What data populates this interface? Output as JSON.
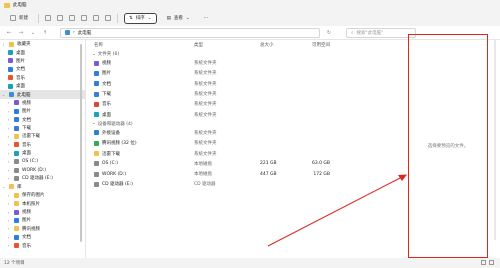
{
  "window": {
    "title": "此电脑"
  },
  "toolbar": {
    "new_label": "新建",
    "sort_label": "排序",
    "view_label": "查看",
    "more_label": "···"
  },
  "address": {
    "path_root": "此电脑",
    "search_placeholder": "搜索\"此电脑\""
  },
  "sidebar": {
    "items": [
      {
        "label": "收藏夹",
        "icon": "star-icon"
      },
      {
        "label": "桌面",
        "icon": "folder-icon"
      },
      {
        "label": "图片",
        "icon": "picture-icon"
      },
      {
        "label": "文档",
        "icon": "document-icon"
      },
      {
        "label": "音乐",
        "icon": "music-icon"
      },
      {
        "label": "桌面",
        "icon": "folder-icon"
      },
      {
        "label": "此电脑",
        "icon": "pc-icon",
        "active": true
      },
      {
        "label": "视频",
        "icon": "video-icon"
      },
      {
        "label": "图片",
        "icon": "picture-icon"
      },
      {
        "label": "文档",
        "icon": "document-icon"
      },
      {
        "label": "下载",
        "icon": "download-icon"
      },
      {
        "label": "迅雷下载",
        "icon": "folder-icon"
      },
      {
        "label": "音乐",
        "icon": "music-icon"
      },
      {
        "label": "桌面",
        "icon": "folder-icon"
      },
      {
        "label": "OS (C:)",
        "icon": "drive-icon"
      },
      {
        "label": "WORK (D:)",
        "icon": "drive-icon"
      },
      {
        "label": "CD 驱动器 (E:)",
        "icon": "cd-icon"
      },
      {
        "label": "库",
        "icon": "library-icon"
      },
      {
        "label": "保存的图片",
        "icon": "folder-icon"
      },
      {
        "label": "本机照片",
        "icon": "folder-icon"
      },
      {
        "label": "视频",
        "icon": "video-icon"
      },
      {
        "label": "图片",
        "icon": "picture-icon"
      },
      {
        "label": "腾讯视频",
        "icon": "folder-icon"
      },
      {
        "label": "文档",
        "icon": "document-icon"
      },
      {
        "label": "音乐",
        "icon": "music-icon"
      }
    ]
  },
  "columns": {
    "name": "名称",
    "type": "类型",
    "total_size": "总大小",
    "free_space": "可用空间"
  },
  "groups": {
    "folders": "文件夹 (6)",
    "devices": "设备和驱动器 (4)"
  },
  "folders": [
    {
      "name": "视频",
      "type": "系统文件夹",
      "icon": "video-icon"
    },
    {
      "name": "图片",
      "type": "系统文件夹",
      "icon": "picture-icon"
    },
    {
      "name": "文档",
      "type": "系统文件夹",
      "icon": "document-icon"
    },
    {
      "name": "下载",
      "type": "系统文件夹",
      "icon": "download-icon"
    },
    {
      "name": "音乐",
      "type": "系统文件夹",
      "icon": "music-icon"
    },
    {
      "name": "桌面",
      "type": "系统文件夹",
      "icon": "desktop-icon"
    }
  ],
  "devices": [
    {
      "name": "外接设备",
      "type": "系统文件夹",
      "total": "",
      "free": "",
      "icon": "device-icon"
    },
    {
      "name": "腾讯视频 (32 位)",
      "type": "系统文件夹",
      "total": "",
      "free": "",
      "icon": "app-icon"
    },
    {
      "name": "迅雷下载",
      "type": "系统文件夹",
      "total": "",
      "free": "",
      "icon": "folder-icon"
    },
    {
      "name": "OS (C:)",
      "type": "本地磁盘",
      "total": "221 GB",
      "free": "63.0 GB",
      "icon": "drive-icon"
    },
    {
      "name": "WORK (D:)",
      "type": "本地磁盘",
      "total": "447 GB",
      "free": "172 GB",
      "icon": "drive-icon"
    },
    {
      "name": "CD 驱动器 (E:)",
      "type": "CD 驱动器",
      "total": "",
      "free": "",
      "icon": "cd-icon"
    }
  ],
  "preview": {
    "text": "选择要预览的文件。"
  },
  "status": {
    "item_count": "12 个项目"
  },
  "colors": {
    "annotation": "#e1251b",
    "selection": "#e5e5e5",
    "folder": "#f2c14e"
  }
}
